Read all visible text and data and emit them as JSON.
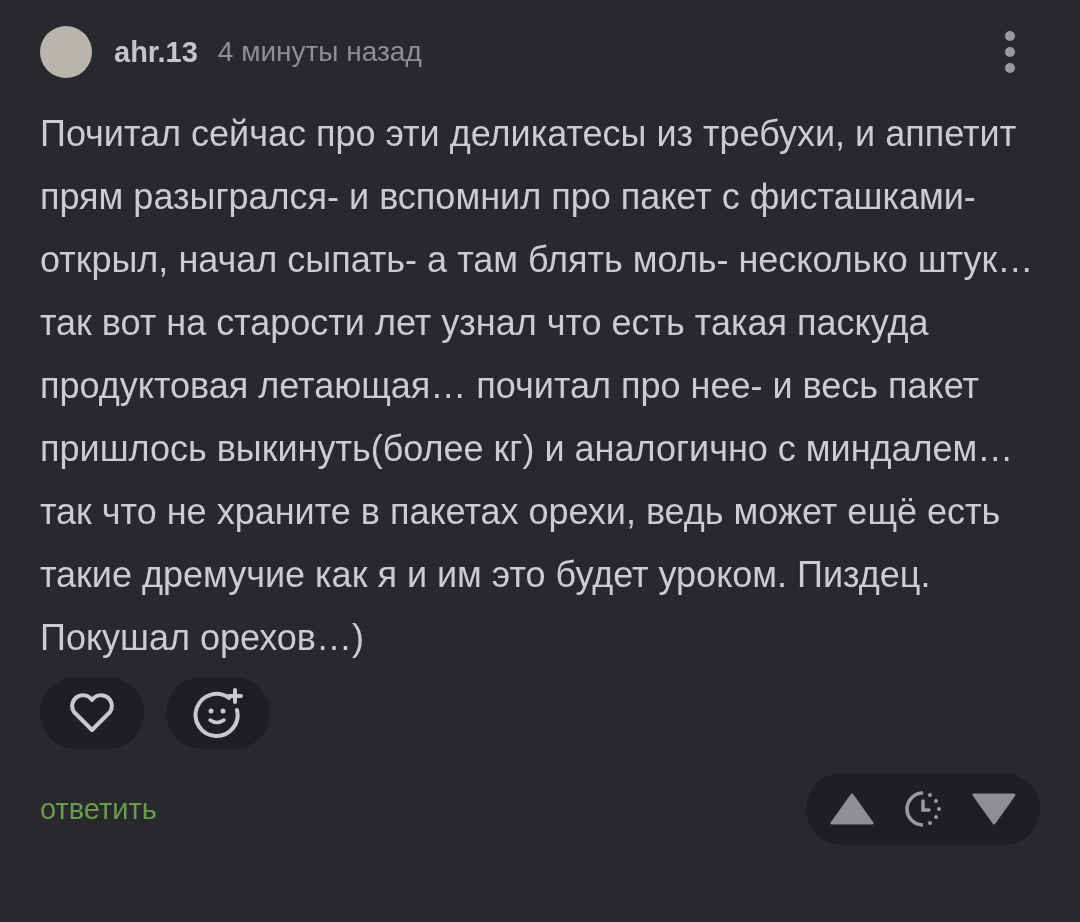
{
  "comment": {
    "author": "ahr.13",
    "time": "4 минуты назад",
    "text": "Почитал сейчас про эти деликатесы из требухи, и аппетит прям разыгрался- и вспомнил про пакет с фисташками- открыл, начал сыпать- а там блять моль- несколько штук… так вот на старости лет узнал что есть такая паскуда продуктовая летающая… почитал про нее- и весь пакет пришлось выкинуть(более кг) и аналогично с миндалем… так что не храните в пакетах орехи, ведь может ещё есть такие дремучие как я и им это будет уроком. Пиздец. Покушал орехов…)",
    "reply": "ответить"
  }
}
